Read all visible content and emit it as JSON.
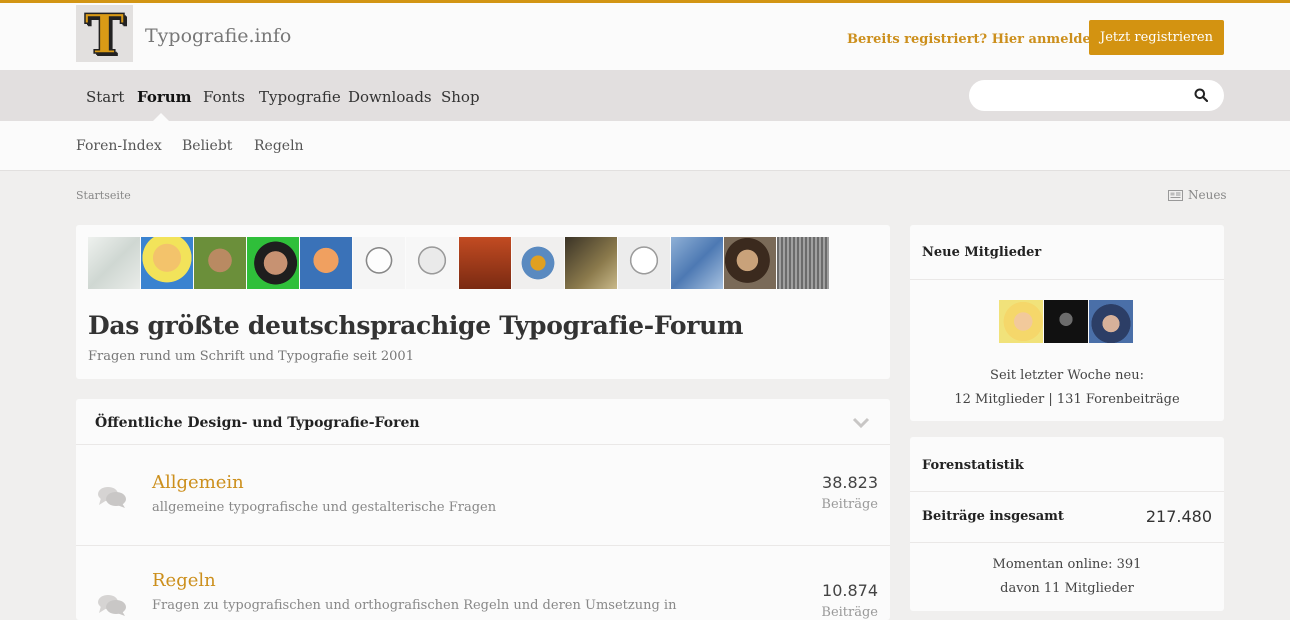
{
  "header": {
    "site_name": "Typografie.info",
    "logo_letter": "T",
    "login_link": "Bereits registriert? Hier anmelden",
    "register_button": "Jetzt registrieren"
  },
  "nav": {
    "items": [
      {
        "label": "Start"
      },
      {
        "label": "Forum"
      },
      {
        "label": "Fonts"
      },
      {
        "label": "Typografie"
      },
      {
        "label": "Downloads"
      },
      {
        "label": "Shop"
      }
    ],
    "active": "Forum",
    "search_placeholder": ""
  },
  "subnav": {
    "items": [
      {
        "label": "Foren-Index"
      },
      {
        "label": "Beliebt"
      },
      {
        "label": "Regeln"
      }
    ]
  },
  "breadcrumb": "Startseite",
  "neues_label": "Neues",
  "hero": {
    "title": "Das größte deutschsprachige Typografie-Forum",
    "subtitle": "Fragen rund um Schrift und Typografie seit 2001"
  },
  "section": {
    "title": "Öffentliche Design- und Typografie-Foren"
  },
  "forums": [
    {
      "title": "Allgemein",
      "description": "allgemeine typografische und gestalterische Fragen",
      "count": "38.823",
      "count_label": "Beiträge"
    },
    {
      "title": "Regeln",
      "description": "Fragen zu typografischen und orthografischen Regeln und deren Umsetzung in",
      "count": "10.874",
      "count_label": "Beiträge"
    }
  ],
  "new_members": {
    "title": "Neue Mitglieder",
    "line1": "Seit letzter Woche neu:",
    "line2": "12 Mitglieder | 131 Forenbeiträge"
  },
  "stats": {
    "title": "Forenstatistik",
    "total_label": "Beiträge insgesamt",
    "total_value": "217.480",
    "online": "Momentan online: 391",
    "online_members": "davon 11 Mitglieder"
  },
  "colors": {
    "accent": "#d39311",
    "link": "#cc8f1c",
    "nav_bg": "#e2dfdf",
    "page_bg": "#f0efee"
  }
}
